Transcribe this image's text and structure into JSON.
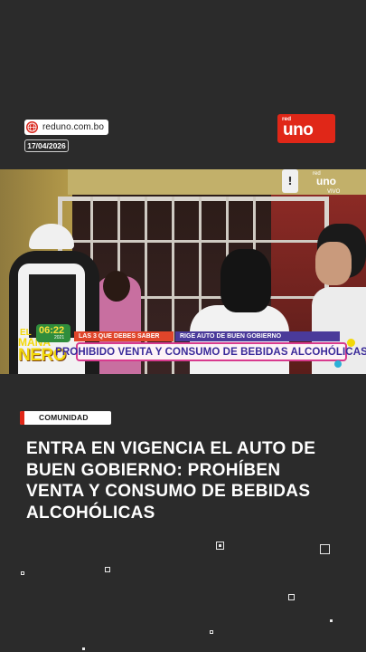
{
  "header": {
    "site": "reduno.com.bo",
    "date": "17/04/2026",
    "logo_small": "red",
    "logo_main": "uno"
  },
  "video": {
    "channel_bug": {
      "small": "red",
      "main": "uno",
      "sub": "VIVO"
    },
    "show": {
      "line1": "EL",
      "line2": "MAÑA",
      "line3": "NERO"
    },
    "clock": {
      "time": "06:22",
      "year": "2021"
    },
    "tags": [
      "LAS 3 QUE DEBES SABER",
      "RIGE AUTO DE BUEN GOBIERNO"
    ],
    "headline": "PROHIBIDO VENTA Y CONSUMO DE BEBIDAS ALCOHÓLICAS"
  },
  "article": {
    "section": "COMUNIDAD",
    "title": "ENTRA EN VIGENCIA EL AUTO DE BUEN GOBIERNO: PROHÍBEN VENTA Y CONSUMO DE BEBIDAS ALCOHÓLICAS"
  },
  "colors": {
    "background": "#2b2b2b",
    "brand_red": "#e02718",
    "headline_text": "#3a2a9a",
    "headline_border": "#d83a8e"
  },
  "icons": [
    "globe-icon"
  ]
}
